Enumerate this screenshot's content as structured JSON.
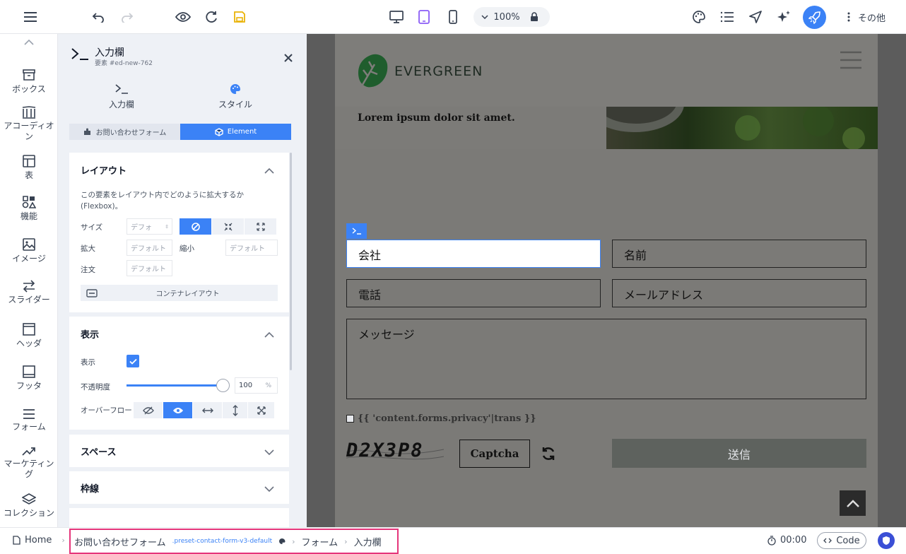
{
  "colors": {
    "accent": "#3b82f6",
    "save": "#eab308",
    "highlight": "#e5357a"
  },
  "toolbar": {
    "zoom": "100%",
    "more_label": "その他"
  },
  "rail": {
    "items": [
      {
        "label": "ボックス",
        "icon": "archive-icon"
      },
      {
        "label": "アコーディオン",
        "icon": "columns-icon"
      },
      {
        "label": "表",
        "icon": "table-icon"
      },
      {
        "label": "機能",
        "icon": "shapes-icon"
      },
      {
        "label": "イメージ",
        "icon": "image-icon"
      },
      {
        "label": "スライダー",
        "icon": "arrows-icon"
      },
      {
        "label": "ヘッダ",
        "icon": "header-icon"
      },
      {
        "label": "フッタ",
        "icon": "footer-icon"
      },
      {
        "label": "フォーム",
        "icon": "list-icon"
      },
      {
        "label": "マーケティング",
        "icon": "trend-icon"
      },
      {
        "label": "コレクション",
        "icon": "layers-icon"
      }
    ]
  },
  "panel": {
    "title": "入力欄",
    "subtitle": "要素 #ed-new-762",
    "tabs": [
      "入力欄",
      "スタイル"
    ],
    "segments": [
      "お問い合わせフォーム",
      "Element"
    ],
    "layout": {
      "heading": "レイアウト",
      "description": "この要素をレイアウト内でどのように拡大するか(Flexbox)。",
      "size_label": "サイズ",
      "size_value": "デフォ",
      "grow_label": "拡大",
      "grow_placeholder": "デフォルト",
      "shrink_label": "縮小",
      "shrink_placeholder": "デフォルト",
      "order_label": "注文",
      "order_placeholder": "デフォルト",
      "container_button": "コンテナレイアウト"
    },
    "display": {
      "heading": "表示",
      "visible_label": "表示",
      "opacity_label": "不透明度",
      "opacity_value": "100",
      "opacity_unit": "%",
      "opacity_level": 1.0,
      "overflow_label": "オーバーフロー"
    },
    "spacing": {
      "heading": "スペース"
    },
    "border": {
      "heading": "枠線"
    }
  },
  "canvas": {
    "brand": "EVERGREEN",
    "lorem": "Lorem ipsum dolor sit amet.",
    "fields": {
      "company": "会社",
      "name": "名前",
      "phone": "電話",
      "email": "メールアドレス",
      "message": "メッセージ"
    },
    "privacy": "{{ 'content.forms.privacy'|trans }}",
    "captcha_text": "D2X3P8",
    "captcha_button": "Captcha",
    "submit": "送信"
  },
  "bottom": {
    "home": "Home",
    "crumbs": [
      "お問い合わせフォーム",
      ".preset-contact-form-v3-default",
      "フォーム",
      "入力欄"
    ],
    "timer": "00:00",
    "code": "Code"
  }
}
